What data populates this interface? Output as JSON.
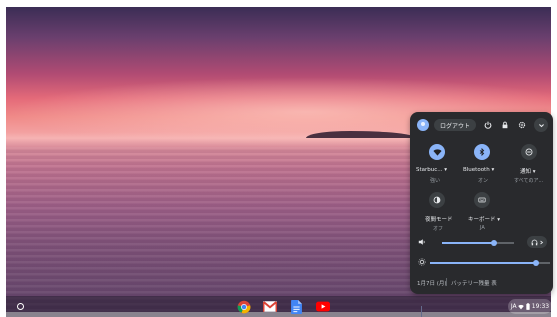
{
  "tray": {
    "signout_label": "ログアウト",
    "network_name": "Starbuc...",
    "network_status": "強い",
    "bluetooth_label": "Bluetooth",
    "bluetooth_status": "オン",
    "notifications_label": "通知",
    "notifications_status": "すべてのア...",
    "night_light_label": "夜間モード",
    "night_light_status": "オフ",
    "keyboard_label": "キーボード",
    "keyboard_status": "JA",
    "date_label": "1月7日 (月)",
    "battery_label": "バッテリー残量 表",
    "volume_level": 0.72,
    "brightness_level": 0.88
  },
  "shelf": {
    "ime": "JA",
    "time": "19:33"
  },
  "colors": {
    "accent": "#8ab4f8",
    "tray_bg": "#292a2d"
  }
}
